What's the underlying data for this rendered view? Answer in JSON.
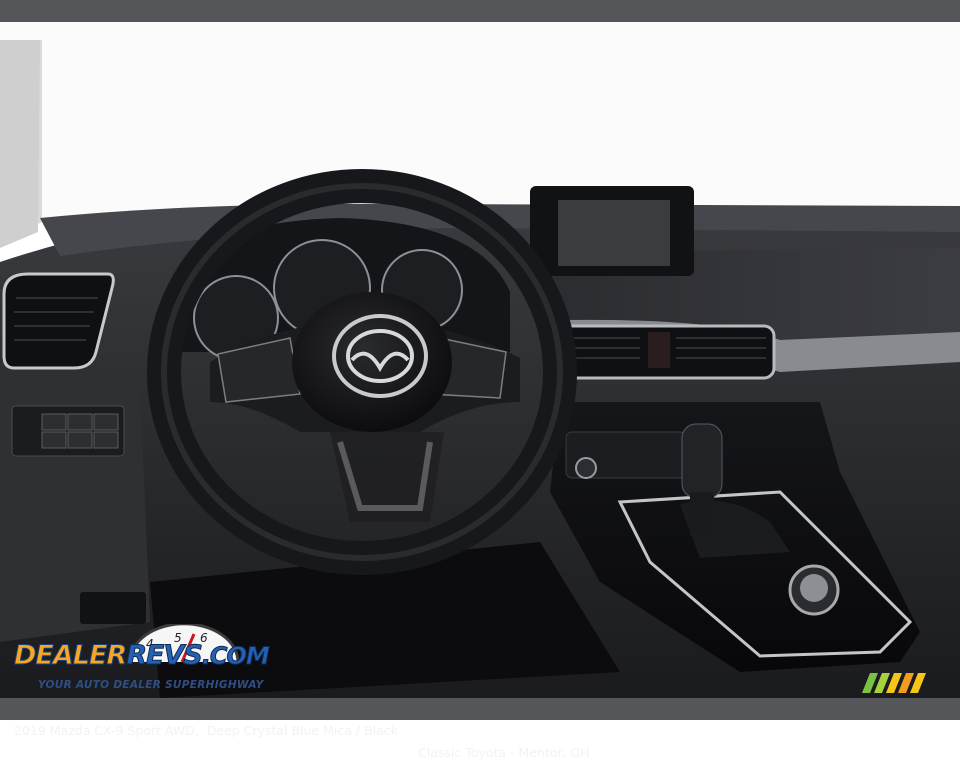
{
  "caption": {
    "vehicle": "2019 Mazda CX-9 Sport AWD,  Deep Crystal Blue Mica / Black",
    "dealer": "Classic Toyota - Mentor, OH"
  },
  "watermark": {
    "brand_dealer": "DEALER",
    "brand_revs": "REVS",
    "brand_com": ".COM",
    "tagline": "YOUR AUTO DEALER SUPERHIGHWAY",
    "gauge_numbers": [
      "4",
      "5",
      "6"
    ]
  },
  "photo": {
    "subject": "steering-wheel-and-dashboard",
    "badge_icon": "mazda-logo-icon"
  },
  "colors": {
    "caption_bar": "#555659",
    "caption_text": "#f2f2f2",
    "dealer_orange": "#f5a623",
    "revs_blue": "#2461b3",
    "tagline_blue": "#2e4f86"
  }
}
